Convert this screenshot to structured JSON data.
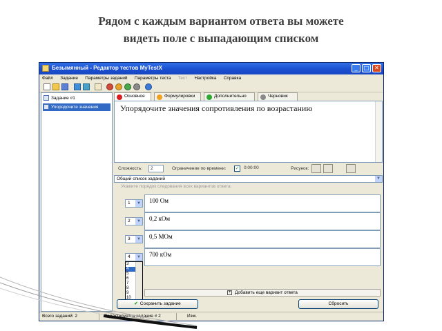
{
  "slide": {
    "title_line1": "Рядом с каждым вариантом ответа вы можете",
    "title_line2": "видеть поле с выпадающим списком"
  },
  "window": {
    "title": "Безымянный - Редактор тестов MyTestX",
    "controls": {
      "minimize": "_",
      "maximize": "□",
      "close": "✕"
    }
  },
  "menu": [
    {
      "label": "Файл",
      "enabled": true
    },
    {
      "label": "Задание",
      "enabled": true
    },
    {
      "label": "Параметры заданий",
      "enabled": true
    },
    {
      "label": "Параметры теста",
      "enabled": true
    },
    {
      "label": "Тест",
      "enabled": false
    },
    {
      "label": "Настройка",
      "enabled": true
    },
    {
      "label": "Справка",
      "enabled": true
    }
  ],
  "tree": {
    "items": [
      {
        "label": "Задание #1",
        "selected": false
      },
      {
        "label": "Упорядочите значения",
        "selected": true
      }
    ]
  },
  "tabs": [
    {
      "label": "Основное",
      "color": "#d81e1e"
    },
    {
      "label": "Формулировки",
      "color": "#f2a11e"
    },
    {
      "label": "Дополнительно",
      "color": "#2fa82f"
    },
    {
      "label": "Черновик",
      "color": "#8a8a8a"
    }
  ],
  "question": {
    "text": "Упорядочите значения сопротивления по возрастанию"
  },
  "options": {
    "difficulty_label": "Сложность:",
    "difficulty_value": "2",
    "time_limit_label": "Ограничение по времени:",
    "time_limit_checked": true,
    "time_value": "0:00:00",
    "picture_label": "Рисунок:"
  },
  "task_list_combo": {
    "value": "Общий список заданий"
  },
  "answers": {
    "hint": "Укажите порядок следования всех вариантов ответа:",
    "items": [
      {
        "order": "1",
        "text": "100 Ом"
      },
      {
        "order": "2",
        "text": "0,2 кОм"
      },
      {
        "order": "3",
        "text": "0,5 МОм"
      },
      {
        "order": "4",
        "text": "700 кОм"
      }
    ],
    "dropdown_options": [
      "3",
      "4",
      "5",
      "6",
      "7",
      "8",
      "9",
      "10"
    ],
    "dropdown_selected": "4",
    "add_label": "Добавить еще вариант ответа"
  },
  "buttons": {
    "save": "Сохранить задание",
    "reset": "Сбросить"
  },
  "status": {
    "total": "Всего заданий: 2",
    "editing": "Редактируется задание # 2",
    "modified": "Изм."
  }
}
